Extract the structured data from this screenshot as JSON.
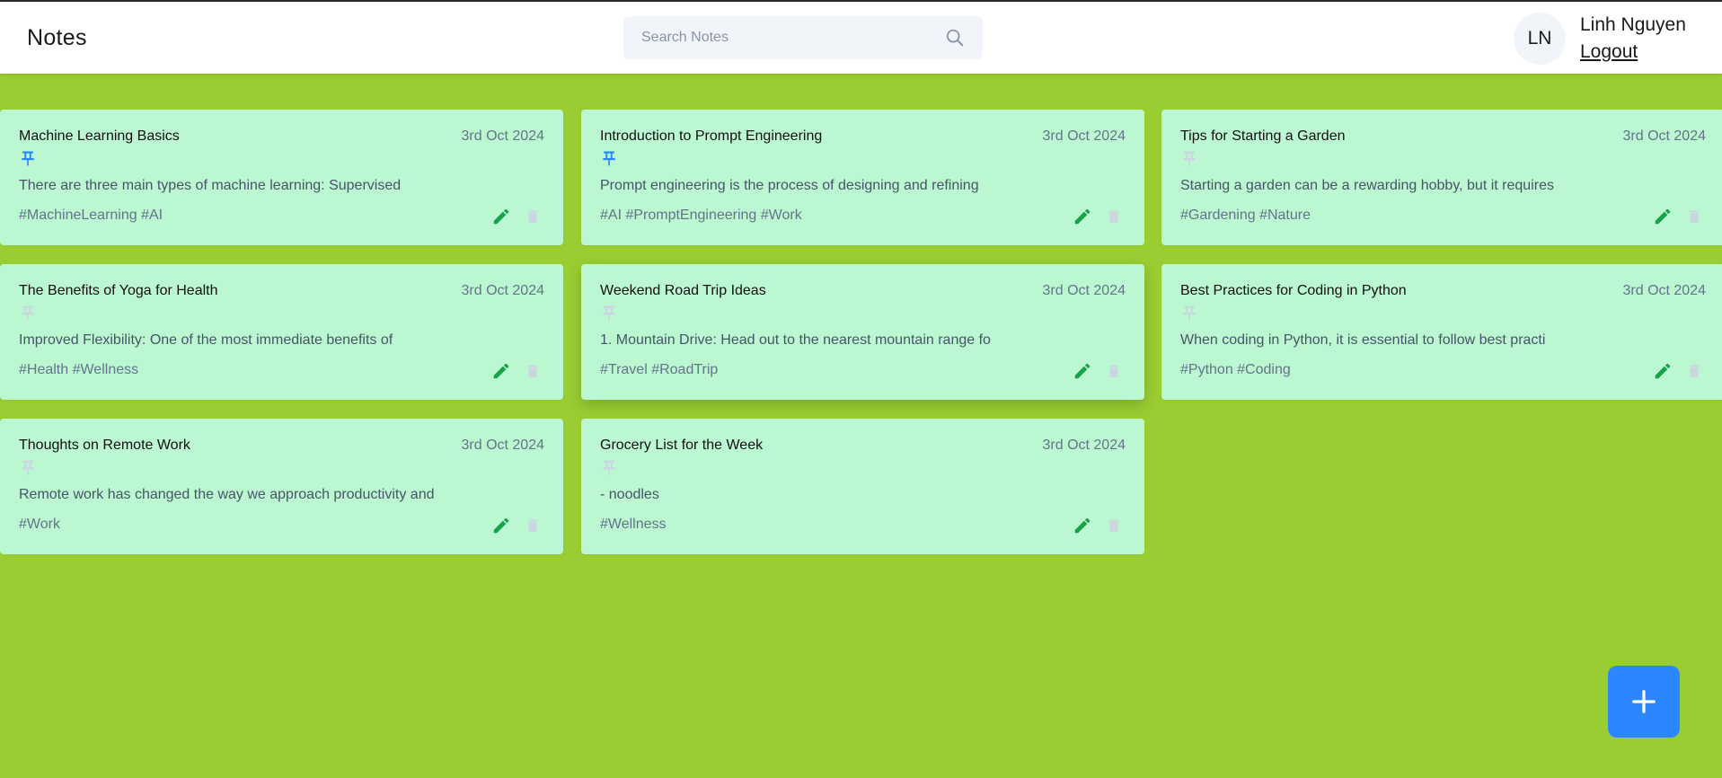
{
  "app": {
    "title": "Notes"
  },
  "search": {
    "placeholder": "Search Notes",
    "value": ""
  },
  "user": {
    "initials": "LN",
    "name": "Linh Nguyen",
    "logout_label": "Logout"
  },
  "colors": {
    "page_bg": "#9acd32",
    "card_bg": "#bbf7d0",
    "pinned": "#2b87ff",
    "unpinned": "#cbd5e1",
    "edit": "#16a34a",
    "delete": "#cbd5e1",
    "fab": "#2b87ff"
  },
  "notes": [
    {
      "title": "Machine Learning Basics",
      "date": "3rd Oct 2024",
      "pinned": true,
      "content": "There are three main types of machine learning: Supervised",
      "tags": "#MachineLearning #AI"
    },
    {
      "title": "Introduction to Prompt Engineering",
      "date": "3rd Oct 2024",
      "pinned": true,
      "content": "Prompt engineering is the process of designing and refining",
      "tags": "#AI #PromptEngineering #Work"
    },
    {
      "title": "Tips for Starting a Garden",
      "date": "3rd Oct 2024",
      "pinned": false,
      "content": "Starting a garden can be a rewarding hobby, but it requires",
      "tags": "#Gardening #Nature"
    },
    {
      "title": "The Benefits of Yoga for Health",
      "date": "3rd Oct 2024",
      "pinned": false,
      "content": "Improved Flexibility: One of the most immediate benefits of",
      "tags": "#Health #Wellness"
    },
    {
      "title": "Weekend Road Trip Ideas",
      "date": "3rd Oct 2024",
      "pinned": false,
      "content": "1. Mountain Drive: Head out to the nearest mountain range fo",
      "tags": "#Travel #RoadTrip"
    },
    {
      "title": "Best Practices for Coding in Python",
      "date": "3rd Oct 2024",
      "pinned": false,
      "content": "When coding in Python, it is essential to follow best practi",
      "tags": "#Python #Coding"
    },
    {
      "title": "Thoughts on Remote Work",
      "date": "3rd Oct 2024",
      "pinned": false,
      "content": "Remote work has changed the way we approach productivity and",
      "tags": "#Work"
    },
    {
      "title": "Grocery List for the Week",
      "date": "3rd Oct 2024",
      "pinned": false,
      "content": "- noodles",
      "tags": "#Wellness"
    }
  ],
  "icons": {
    "search": "search-icon",
    "pin": "pin-icon",
    "edit": "pencil-icon",
    "delete": "trash-icon",
    "add": "plus-icon"
  }
}
